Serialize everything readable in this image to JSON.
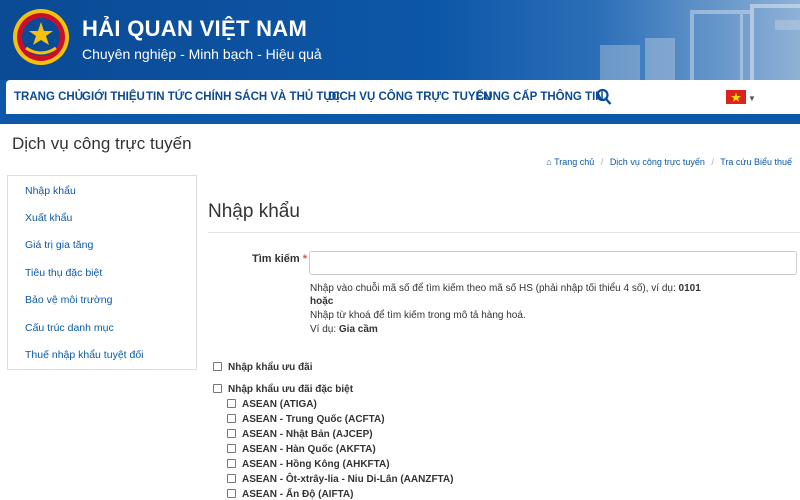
{
  "header": {
    "brand_title": "HẢI QUAN VIỆT NAM",
    "brand_subtitle": "Chuyên nghiệp - Minh bạch - Hiệu quả",
    "logo_icon": "customs-emblem-icon"
  },
  "nav": {
    "items": [
      {
        "label": "TRANG CHỦ"
      },
      {
        "label": "GIỚI THIỆU"
      },
      {
        "label": "TIN TỨC"
      },
      {
        "label": "CHÍNH SÁCH VÀ THỦ TỤC"
      },
      {
        "label": "DỊCH VỤ CÔNG TRỰC TUYẾN"
      },
      {
        "label": "CUNG CẤP THÔNG TIN"
      }
    ],
    "search_icon": "search-icon",
    "language_flag": "vietnam-flag-icon",
    "colors": {
      "brand": "#0b4a94",
      "flag": "#da251d"
    }
  },
  "page": {
    "title": "Dịch vụ công trực tuyến"
  },
  "breadcrumb": {
    "items": [
      "Trang chủ",
      "Dịch vụ công trực tuyến",
      "Tra cứu Biểu thuế"
    ]
  },
  "sidebar": {
    "items": [
      {
        "label": "Nhập khẩu"
      },
      {
        "label": "Xuất khẩu"
      },
      {
        "label": "Giá trị gia tăng"
      },
      {
        "label": "Tiêu thụ đặc biệt"
      },
      {
        "label": "Bảo vệ môi trường"
      },
      {
        "label": "Cấu trúc danh mục"
      },
      {
        "label": "Thuế nhập khẩu tuyệt đối"
      }
    ]
  },
  "main": {
    "title": "Nhập khẩu",
    "search": {
      "label": "Tìm kiếm",
      "required_mark": "*",
      "value": ""
    },
    "help": {
      "line1_text": "Nhập vào chuỗi mã số để tìm kiếm theo mã số HS (phải nhập tối thiểu 4 số), ví dụ: ",
      "line1_example": "0101",
      "line2": "hoặc",
      "line3": "Nhập từ khoá để tìm kiếm trong mô tả hàng hoá.",
      "line4_text": "Ví dụ: ",
      "line4_example": "Gia cầm"
    },
    "checkboxes": {
      "preferential": {
        "label": "Nhập khẩu ưu đãi",
        "checked": false
      },
      "special_preferential": {
        "label": "Nhập khẩu ưu đãi đặc biệt",
        "checked": false
      },
      "agreements": [
        {
          "label": "ASEAN (ATIGA)",
          "checked": false
        },
        {
          "label": "ASEAN - Trung Quốc (ACFTA)",
          "checked": false
        },
        {
          "label": "ASEAN - Nhật Bản (AJCEP)",
          "checked": false
        },
        {
          "label": "ASEAN - Hàn Quốc (AKFTA)",
          "checked": false
        },
        {
          "label": "ASEAN - Hồng Kông (AHKFTA)",
          "checked": false
        },
        {
          "label": "ASEAN - Ôt-xtrây-lia - Niu Di-Lân (AANZFTA)",
          "checked": false
        },
        {
          "label": "ASEAN - Ấn Độ (AIFTA)",
          "checked": false
        }
      ]
    }
  }
}
